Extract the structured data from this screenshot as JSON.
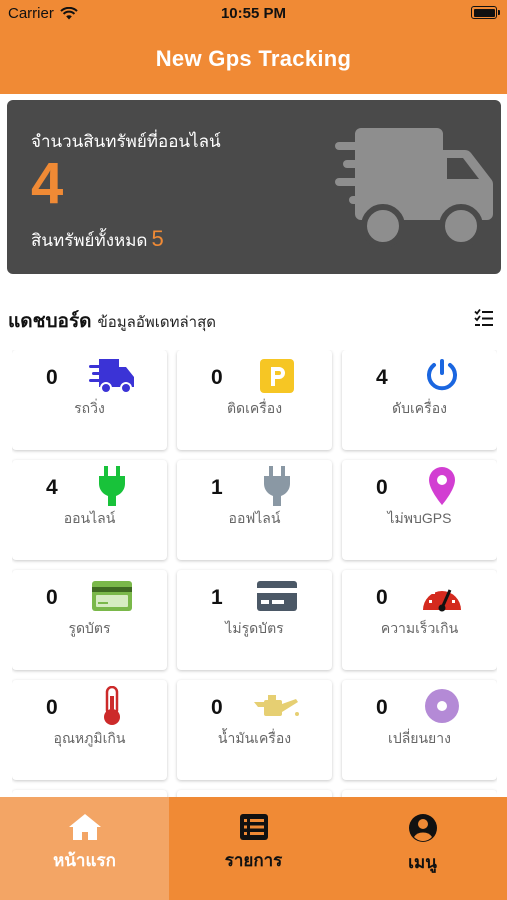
{
  "status": {
    "carrier": "Carrier",
    "time": "10:55 PM"
  },
  "header": {
    "title": "New Gps Tracking"
  },
  "summary": {
    "online_label": "จำนวนสินทรัพย์ที่ออนไลน์",
    "online_count": "4",
    "total_label": "สินทรัพย์ทั้งหมด",
    "total_count": "5"
  },
  "dashboard": {
    "title": "แดชบอร์ด",
    "subtitle": "ข้อมูลอัพเดทล่าสุด",
    "tiles": [
      {
        "count": "0",
        "label": "รถวิ่ง",
        "icon": "moving-truck-icon",
        "color": "#3b33d6"
      },
      {
        "count": "0",
        "label": "ติดเครื่อง",
        "icon": "parking-icon",
        "color": "#f6c624"
      },
      {
        "count": "4",
        "label": "ดับเครื่อง",
        "icon": "power-icon",
        "color": "#1a66e0"
      },
      {
        "count": "4",
        "label": "ออนไลน์",
        "icon": "plug-online-icon",
        "color": "#18c23a"
      },
      {
        "count": "1",
        "label": "ออฟไลน์",
        "icon": "plug-offline-icon",
        "color": "#8a98a4"
      },
      {
        "count": "0",
        "label": "ไม่พบGPS",
        "icon": "map-pin-icon",
        "color": "#d23ed2"
      },
      {
        "count": "0",
        "label": "รูดบัตร",
        "icon": "card-icon",
        "color": "#7ab84a"
      },
      {
        "count": "1",
        "label": "ไม่รูดบัตร",
        "icon": "card-dark-icon",
        "color": "#4b5866"
      },
      {
        "count": "0",
        "label": "ความเร็วเกิน",
        "icon": "speedometer-icon",
        "color": "#d42a1e"
      },
      {
        "count": "0",
        "label": "อุณหภูมิเกิน",
        "icon": "thermometer-icon",
        "color": "#cc2a2a"
      },
      {
        "count": "0",
        "label": "น้ำมันเครื่อง",
        "icon": "oil-can-icon",
        "color": "#e6cf72"
      },
      {
        "count": "0",
        "label": "เปลี่ยนยาง",
        "icon": "tire-icon",
        "color": "#b48ad6"
      }
    ]
  },
  "nav": [
    {
      "label": "หน้าแรก",
      "icon": "home-icon"
    },
    {
      "label": "รายการ",
      "icon": "list-icon"
    },
    {
      "label": "เมนู",
      "icon": "user-icon"
    }
  ]
}
